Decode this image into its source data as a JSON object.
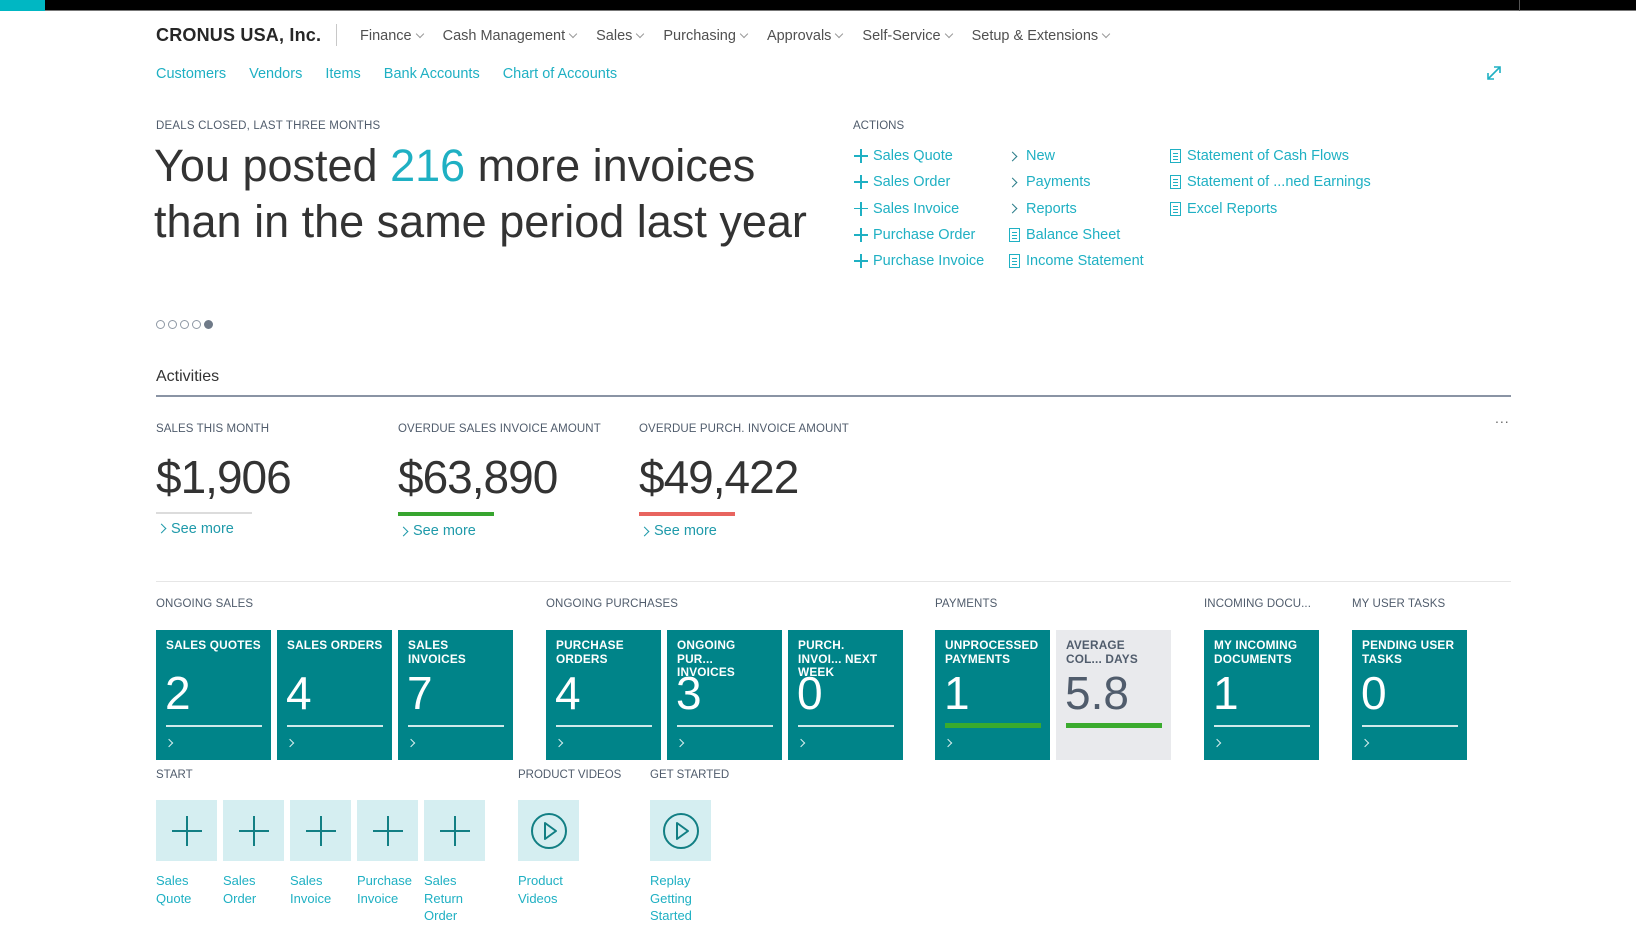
{
  "header": {
    "company": "CRONUS USA, Inc.",
    "nav": [
      "Finance",
      "Cash Management",
      "Sales",
      "Purchasing",
      "Approvals",
      "Self-Service",
      "Setup & Extensions"
    ],
    "subnav": [
      "Customers",
      "Vendors",
      "Items",
      "Bank Accounts",
      "Chart of Accounts"
    ],
    "expand_icon": "expand-icon"
  },
  "headline": {
    "label": "DEALS CLOSED, LAST THREE MONTHS",
    "text_before": "You posted ",
    "highlight": "216",
    "text_after": " more invoices than in the same period last year",
    "pager": {
      "count": 5,
      "active_index": 4
    }
  },
  "actions": {
    "label": "ACTIONS",
    "columns": [
      [
        {
          "icon": "plus",
          "label": "Sales Quote"
        },
        {
          "icon": "plus",
          "label": "Sales Order"
        },
        {
          "icon": "plus",
          "label": "Sales Invoice"
        },
        {
          "icon": "plus",
          "label": "Purchase Order"
        },
        {
          "icon": "plus",
          "label": "Purchase Invoice"
        }
      ],
      [
        {
          "icon": "chevron",
          "label": "New"
        },
        {
          "icon": "chevron",
          "label": "Payments"
        },
        {
          "icon": "chevron",
          "label": "Reports"
        },
        {
          "icon": "report",
          "label": "Balance Sheet"
        },
        {
          "icon": "report",
          "label": "Income Statement"
        }
      ],
      [
        {
          "icon": "report",
          "label": "Statement of Cash Flows"
        },
        {
          "icon": "report",
          "label": "Statement of ...ned Earnings"
        },
        {
          "icon": "report",
          "label": "Excel Reports"
        }
      ]
    ]
  },
  "activities": {
    "title": "Activities",
    "more": "...",
    "kpis": [
      {
        "label": "SALES THIS MONTH",
        "value": "$1,906",
        "bar_color": "#dcdcdc",
        "see_more": "See more"
      },
      {
        "label": "OVERDUE SALES INVOICE AMOUNT",
        "value": "$63,890",
        "bar_color": "#37a52f",
        "see_more": "See more"
      },
      {
        "label": "OVERDUE PURCH. INVOICE AMOUNT",
        "value": "$49,422",
        "bar_color": "#e8645f",
        "see_more": "See more"
      }
    ],
    "groups": [
      {
        "label": "ONGOING SALES",
        "tiles": [
          {
            "label": "SALES QUOTES",
            "value": "2"
          },
          {
            "label": "SALES ORDERS",
            "value": "4"
          },
          {
            "label": "SALES INVOICES",
            "value": "7"
          }
        ]
      },
      {
        "label": "ONGOING PURCHASES",
        "tiles": [
          {
            "label": "PURCHASE ORDERS",
            "value": "4"
          },
          {
            "label": "ONGOING PUR... INVOICES",
            "value": "3"
          },
          {
            "label": "PURCH. INVOI... NEXT WEEK",
            "value": "0"
          }
        ]
      },
      {
        "label": "PAYMENTS",
        "tiles": [
          {
            "label": "UNPROCESSED PAYMENTS",
            "value": "1"
          },
          {
            "label": "AVERAGE COL... DAYS",
            "value": "5.8"
          }
        ]
      },
      {
        "label": "INCOMING DOCU...",
        "tiles": [
          {
            "label": "MY INCOMING DOCUMENTS",
            "value": "1"
          }
        ]
      },
      {
        "label": "MY USER TASKS",
        "tiles": [
          {
            "label": "PENDING USER TASKS",
            "value": "0"
          }
        ]
      }
    ]
  },
  "start": {
    "label": "START",
    "items": [
      "Sales Quote",
      "Sales Order",
      "Sales Invoice",
      "Purchase Invoice",
      "Sales Return Order"
    ]
  },
  "product_videos": {
    "label": "PRODUCT VIDEOS",
    "item": "Product Videos"
  },
  "get_started": {
    "label": "GET STARTED",
    "item": "Replay Getting Started"
  },
  "colors": {
    "accent": "#1fb0c3",
    "tile": "#008489",
    "tile_light": "#e9eaed",
    "green": "#37a52f",
    "red": "#e8645f",
    "start_tile": "#d5eef1"
  }
}
